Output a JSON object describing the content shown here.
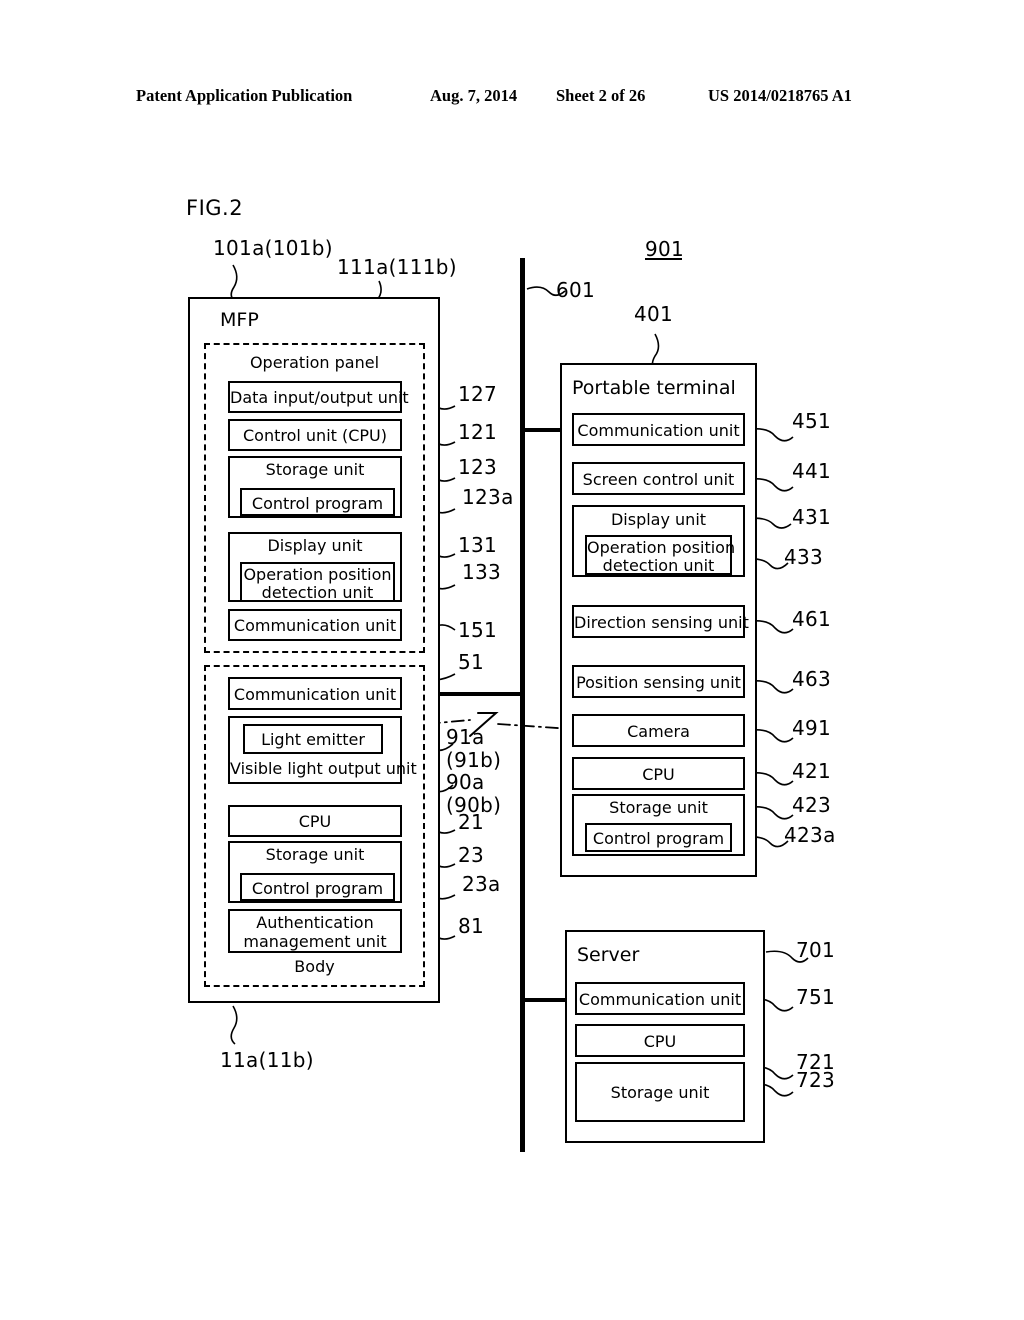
{
  "header": {
    "publication": "Patent Application Publication",
    "date": "Aug. 7, 2014",
    "sheet": "Sheet 2 of 26",
    "docnum": "US 2014/0218765 A1"
  },
  "figure": {
    "label": "FIG.2",
    "system_ref": "901"
  },
  "mfp": {
    "title": "MFP",
    "outer_ref": "101a(101b)",
    "body_bottom_ref": "11a(11b)",
    "panel": {
      "title": "Operation panel",
      "ref": "111a(111b)",
      "units": [
        {
          "label": "Data input/output unit",
          "ref": "127"
        },
        {
          "label": "Control unit (CPU)",
          "ref": "121"
        },
        {
          "label": "Storage unit",
          "ref": "123"
        },
        {
          "label": "Control program",
          "ref": "123a"
        },
        {
          "label": "Display unit",
          "ref": "131"
        },
        {
          "label": "Operation position\ndetection unit",
          "ref": "133"
        },
        {
          "label": "Communication unit",
          "ref": "151"
        }
      ]
    },
    "body": {
      "title": "Body",
      "units": [
        {
          "label": "Communication unit",
          "ref": "51"
        },
        {
          "label": "Light emitter",
          "ref": "91a\n(91b)"
        },
        {
          "label": "Visible light output unit",
          "ref": "90a\n(90b)"
        },
        {
          "label": "CPU",
          "ref": "21"
        },
        {
          "label": "Storage unit",
          "ref": "23"
        },
        {
          "label": "Control program",
          "ref": "23a"
        },
        {
          "label": "Authentication\nmanagement unit",
          "ref": "81"
        }
      ]
    }
  },
  "network": {
    "ref": "601"
  },
  "terminal": {
    "title": "Portable terminal",
    "ref": "401",
    "units": [
      {
        "label": "Communication unit",
        "ref": "451"
      },
      {
        "label": "Screen control unit",
        "ref": "441"
      },
      {
        "label": "Display unit",
        "ref": "431"
      },
      {
        "label": "Operation position\ndetection unit",
        "ref": "433"
      },
      {
        "label": "Direction sensing unit",
        "ref": "461"
      },
      {
        "label": "Position sensing unit",
        "ref": "463"
      },
      {
        "label": "Camera",
        "ref": "491"
      },
      {
        "label": "CPU",
        "ref": "421"
      },
      {
        "label": "Storage unit",
        "ref": "423"
      },
      {
        "label": "Control program",
        "ref": "423a"
      }
    ]
  },
  "server": {
    "title": "Server",
    "ref": "701",
    "units": [
      {
        "label": "Communication unit",
        "ref": "751"
      },
      {
        "label": "CPU",
        "ref": "721"
      },
      {
        "label": "Storage unit",
        "ref": "723"
      }
    ]
  },
  "refs": {
    "ref_101a": "101a(101b)",
    "ref_111a": "111a(111b)",
    "ref_11a": "11a(11b)",
    "ref_127": "127",
    "ref_121": "121",
    "ref_123": "123",
    "ref_123a": "123a",
    "ref_131": "131",
    "ref_133": "133",
    "ref_151": "151",
    "ref_51": "51",
    "ref_91a": "91a",
    "ref_91b": "(91b)",
    "ref_90a": "90a",
    "ref_90b": "(90b)",
    "ref_21": "21",
    "ref_23": "23",
    "ref_23a": "23a",
    "ref_81": "81",
    "ref_601": "601",
    "ref_401": "401",
    "ref_901": "901",
    "ref_451": "451",
    "ref_441": "441",
    "ref_431": "431",
    "ref_433": "433",
    "ref_461": "461",
    "ref_463": "463",
    "ref_491": "491",
    "ref_421": "421",
    "ref_423": "423",
    "ref_423a": "423a",
    "ref_701": "701",
    "ref_751": "751",
    "ref_721": "721",
    "ref_723": "723"
  },
  "labels": {
    "mfp": "MFP",
    "operation_panel": "Operation panel",
    "body": "Body",
    "portable_terminal": "Portable terminal",
    "server": "Server",
    "data_io": "Data input/output unit",
    "control_unit_cpu": "Control unit (CPU)",
    "storage_unit": "Storage unit",
    "control_program": "Control program",
    "display_unit": "Display unit",
    "op_pos_1": "Operation position",
    "op_pos_2": "detection unit",
    "communication_unit": "Communication unit",
    "light_emitter": "Light emitter",
    "visible_light": "Visible light output unit",
    "cpu": "CPU",
    "auth_1": "Authentication",
    "auth_2": "management unit",
    "screen_control": "Screen control unit",
    "direction_sensing": "Direction sensing unit",
    "position_sensing": "Position sensing unit",
    "camera": "Camera"
  },
  "colors": {
    "ink": "#000000",
    "paper": "#ffffff"
  }
}
